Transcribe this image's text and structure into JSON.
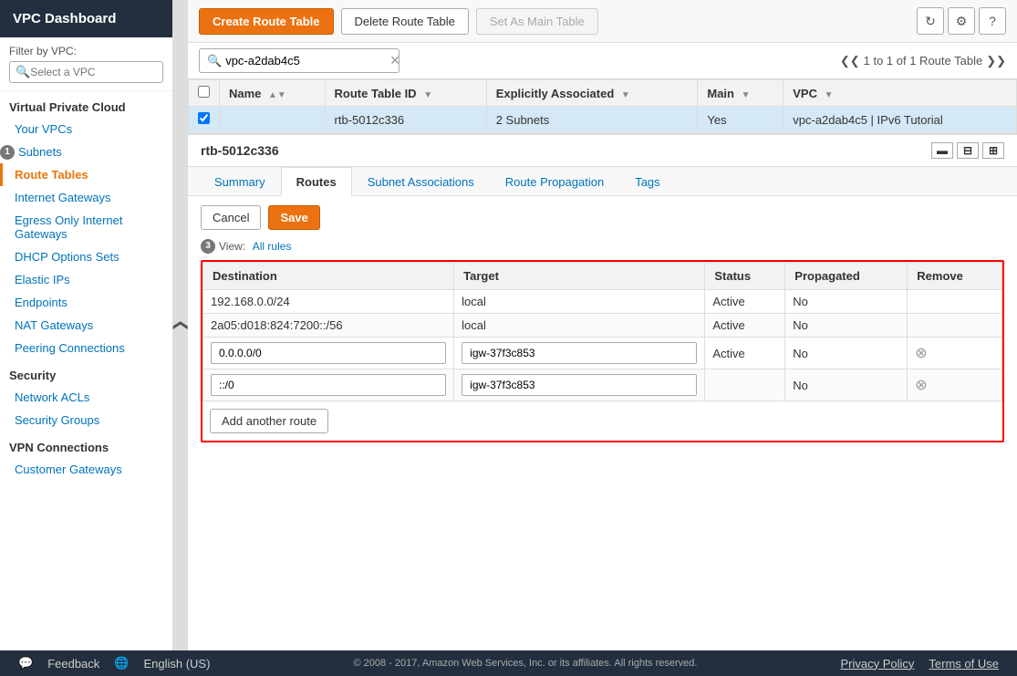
{
  "sidebar": {
    "title": "VPC Dashboard",
    "filter_label": "Filter by VPC:",
    "filter_placeholder": "Select a VPC",
    "sections": [
      {
        "title": "Virtual Private Cloud",
        "items": [
          {
            "label": "Your VPCs",
            "active": false,
            "name": "your-vpcs"
          },
          {
            "label": "Subnets",
            "active": false,
            "name": "subnets",
            "step": "1"
          },
          {
            "label": "Route Tables",
            "active": true,
            "name": "route-tables"
          },
          {
            "label": "Internet Gateways",
            "active": false,
            "name": "internet-gateways"
          },
          {
            "label": "Egress Only Internet Gateways",
            "active": false,
            "name": "egress-only-igw"
          },
          {
            "label": "DHCP Options Sets",
            "active": false,
            "name": "dhcp-options"
          },
          {
            "label": "Elastic IPs",
            "active": false,
            "name": "elastic-ips"
          },
          {
            "label": "Endpoints",
            "active": false,
            "name": "endpoints"
          },
          {
            "label": "NAT Gateways",
            "active": false,
            "name": "nat-gateways"
          },
          {
            "label": "Peering Connections",
            "active": false,
            "name": "peering-connections"
          }
        ]
      },
      {
        "title": "Security",
        "items": [
          {
            "label": "Network ACLs",
            "active": false,
            "name": "network-acls"
          },
          {
            "label": "Security Groups",
            "active": false,
            "name": "security-groups"
          }
        ]
      },
      {
        "title": "VPN Connections",
        "items": [
          {
            "label": "Customer Gateways",
            "active": false,
            "name": "customer-gateways"
          }
        ]
      }
    ]
  },
  "toolbar": {
    "create_label": "Create Route Table",
    "delete_label": "Delete Route Table",
    "set_main_label": "Set As Main Table"
  },
  "table": {
    "search_value": "vpc-a2dab4c5",
    "pagination": "1 to 1 of 1 Route Table",
    "columns": [
      "Name",
      "Route Table ID",
      "Explicitly Associated",
      "Main",
      "VPC"
    ],
    "rows": [
      {
        "name": "",
        "route_table_id": "rtb-5012c336",
        "explicitly_associated": "2 Subnets",
        "main": "Yes",
        "vpc": "vpc-a2dab4c5 | IPv6 Tutorial",
        "selected": true
      }
    ]
  },
  "detail": {
    "title": "rtb-5012c336",
    "tabs": [
      "Summary",
      "Routes",
      "Subnet Associations",
      "Route Propagation",
      "Tags"
    ],
    "active_tab": "Routes",
    "routes": {
      "view_label": "View:",
      "view_value": "All rules",
      "cancel_label": "Cancel",
      "save_label": "Save",
      "add_route_label": "Add another route",
      "columns": [
        "Destination",
        "Target",
        "Status",
        "Propagated",
        "Remove"
      ],
      "rows": [
        {
          "destination": "192.168.0.0/24",
          "target": "local",
          "status": "Active",
          "propagated": "No",
          "editable": false
        },
        {
          "destination": "2a05:d018:824:7200::/56",
          "target": "local",
          "status": "Active",
          "propagated": "No",
          "editable": false
        },
        {
          "destination": "0.0.0.0/0",
          "target": "igw-37f3c853",
          "status": "Active",
          "propagated": "No",
          "editable": true
        },
        {
          "destination": "::/0",
          "target": "igw-37f3c853",
          "status": "",
          "propagated": "No",
          "editable": true
        }
      ]
    }
  },
  "footer": {
    "feedback_label": "Feedback",
    "language_label": "English (US)",
    "copyright": "© 2008 - 2017, Amazon Web Services, Inc. or its affiliates. All rights reserved.",
    "privacy_label": "Privacy Policy",
    "terms_label": "Terms of Use"
  },
  "step_labels": {
    "step1": "1",
    "step3": "3"
  }
}
